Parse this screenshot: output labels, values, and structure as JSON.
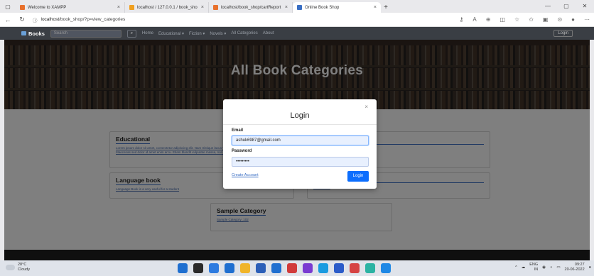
{
  "browser": {
    "tabs": [
      {
        "label": "Welcome to XAMPP",
        "favicon_color": "#e8712d",
        "active": false
      },
      {
        "label": "localhost / 127.0.0.1 / book_sho",
        "favicon_color": "#f0a020",
        "active": false
      },
      {
        "label": "localhost/book_shop/cartReport",
        "favicon_color": "#e8712d",
        "active": false
      },
      {
        "label": "Online Book Shop",
        "favicon_color": "#3a6fc4",
        "active": true
      }
    ],
    "new_tab": "+",
    "url_host": "localhost",
    "url_path": "/book_shop/?p=view_categories"
  },
  "site": {
    "brand": "Books",
    "search_placeholder": "Search",
    "nav_links": [
      "Home",
      "Educational ▾",
      "Fiction ▾",
      "Novels ▾",
      "All Categories",
      "About"
    ],
    "login_button": "Login",
    "hero_title": "All Book Categories"
  },
  "categories": [
    {
      "title": "Educational",
      "desc": "Lorem ipsum dolor sit amet, consectetur adipiscing elit. Nam tristique lacus vel lacus tempor bibendum a nec orda. Maecenas sed dolor id amet enim arcu. Etiam blandit vulputate massa, non bibendum"
    },
    {
      "title": "Language book",
      "desc": "Language Book is a very useful for a student"
    },
    {
      "title": "Sample Category",
      "desc": "Sample Category_102"
    }
  ],
  "right_cards": [
    {
      "desc": ""
    },
    {
      "desc": "Sample text"
    }
  ],
  "modal": {
    "title": "Login",
    "close": "×",
    "email_label": "Email",
    "email_value": "ashuk6987@gmail.com",
    "password_label": "Password",
    "password_value": "•••••••••",
    "create_account": "Create Account",
    "submit": "Login"
  },
  "taskbar": {
    "temp": "28°C",
    "weather": "Cloudy",
    "lang_top": "ENG",
    "lang_bottom": "IN",
    "time": "09:27",
    "date": "20-06-2022",
    "app_colors": [
      "#1f6fd0",
      "#2a2a2a",
      "#2d7be0",
      "#1f6fd0",
      "#f0b429",
      "#2c5fb8",
      "#1f6fd0",
      "#d13b3b",
      "#7a3bd1",
      "#1a9be0",
      "#2b5cc9",
      "#d64343",
      "#2bb3a3",
      "#1e88e5"
    ]
  }
}
